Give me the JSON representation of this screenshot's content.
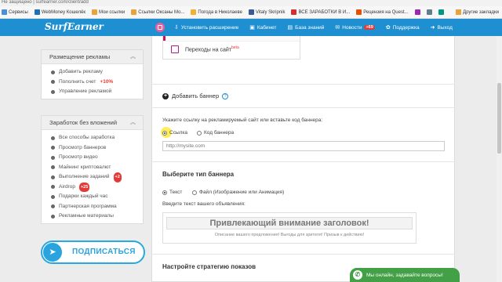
{
  "browser": {
    "address": "Не защищено  |  surfearner.com/client/add",
    "bookmarks": [
      "Сервисы",
      "WebMoney Кошелёк",
      "Мои ссылки",
      "Ссылки Оксаны Мо...",
      "Погода в Николаеве",
      "Vitaly Skripnik",
      "ВСЕ ЗАРАБОТКИ В И...",
      "Рецензия на Quest...",
      "",
      "",
      ""
    ],
    "other_bookmarks": "Другие закладки"
  },
  "nav": {
    "logo": "SurfEarner",
    "items": [
      {
        "label": "Установить расширение",
        "glyph": "⇩"
      },
      {
        "label": "Кабинет",
        "glyph": "▣"
      },
      {
        "label": "База знаний",
        "glyph": "▤"
      },
      {
        "label": "Новости",
        "glyph": "✉",
        "badge": "+69"
      },
      {
        "label": "Поддержка",
        "glyph": "✿"
      },
      {
        "label": "Выход",
        "glyph": "➜"
      }
    ]
  },
  "sidebar": {
    "ads": {
      "title": "Размещение рекламы",
      "items": [
        {
          "label": "Добавить рекламу"
        },
        {
          "label": "Пополнить счет",
          "extra": "+10%"
        },
        {
          "label": "Управление рекламой"
        }
      ]
    },
    "earn": {
      "title": "Заработок без вложений",
      "items": [
        {
          "label": "Все способы заработка"
        },
        {
          "label": "Просмотр баннеров"
        },
        {
          "label": "Просмотр видео"
        },
        {
          "label": "Майнинг криптовалют"
        },
        {
          "label": "Выполнение заданий",
          "badge": "+2"
        },
        {
          "label": "Airdrop",
          "badge": "+25"
        },
        {
          "label": "Подарки каждый час"
        },
        {
          "label": "Партнерская программа"
        },
        {
          "label": "Рекламные материалы"
        }
      ]
    },
    "subscribe_label": "ПОДПИСАТЬСЯ"
  },
  "main": {
    "visits_label": "Переходы на сайт",
    "visits_sup": "beta",
    "add_banner": "Добавить баннер",
    "link_prompt": "Укажите ссылку на рекламируемый сайт или вставьте код баннера:",
    "radio_link": "Ссылка",
    "radio_code": "Код баннера",
    "url_placeholder": "http://mysite.com",
    "banner_type_title": "Выберите тип баннера",
    "type_text": "Текст",
    "type_file": "Файл (Изображение или Анимация)",
    "ad_text_prompt": "Введите текст вашего объявления:",
    "preview_headline": "Привлекающий внимание заголовок!",
    "preview_sub": "Описание вашего предложения! Выгоды для зрителя! Призыв к действию!",
    "strategy_title": "Настройте стратегию показов"
  },
  "chat_label": "Мы онлайн, задавайте вопросы!",
  "colors": {
    "brand": "#1e8fd0",
    "badge": "#e53935",
    "telegram": "#2aa3df",
    "chat": "#43a047"
  }
}
